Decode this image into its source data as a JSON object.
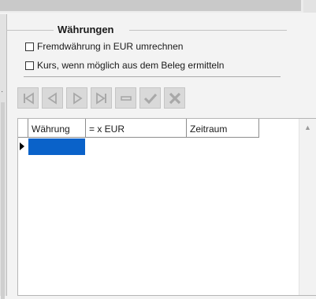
{
  "waehrungen_group": {
    "title": "Währungen",
    "checkbox_1": {
      "label": "Fremdwährung in EUR umrechnen",
      "checked": false
    },
    "checkbox_2": {
      "label": "Kurs, wenn möglich aus dem Beleg ermitteln",
      "checked": false
    }
  },
  "navigator": {
    "buttons": [
      {
        "name": "first-record",
        "icon": "first-icon"
      },
      {
        "name": "prior-record",
        "icon": "prior-icon"
      },
      {
        "name": "next-record",
        "icon": "next-icon"
      },
      {
        "name": "last-record",
        "icon": "last-icon"
      },
      {
        "name": "delete-record",
        "icon": "minus-icon"
      },
      {
        "name": "post-record",
        "icon": "check-icon"
      },
      {
        "name": "cancel-record",
        "icon": "x-icon"
      }
    ],
    "color_disabled": "#a8a8a8"
  },
  "grid": {
    "columns": [
      "Währung",
      "= x EUR",
      "Zeitraum"
    ],
    "selection_color": "#0a62c9"
  }
}
